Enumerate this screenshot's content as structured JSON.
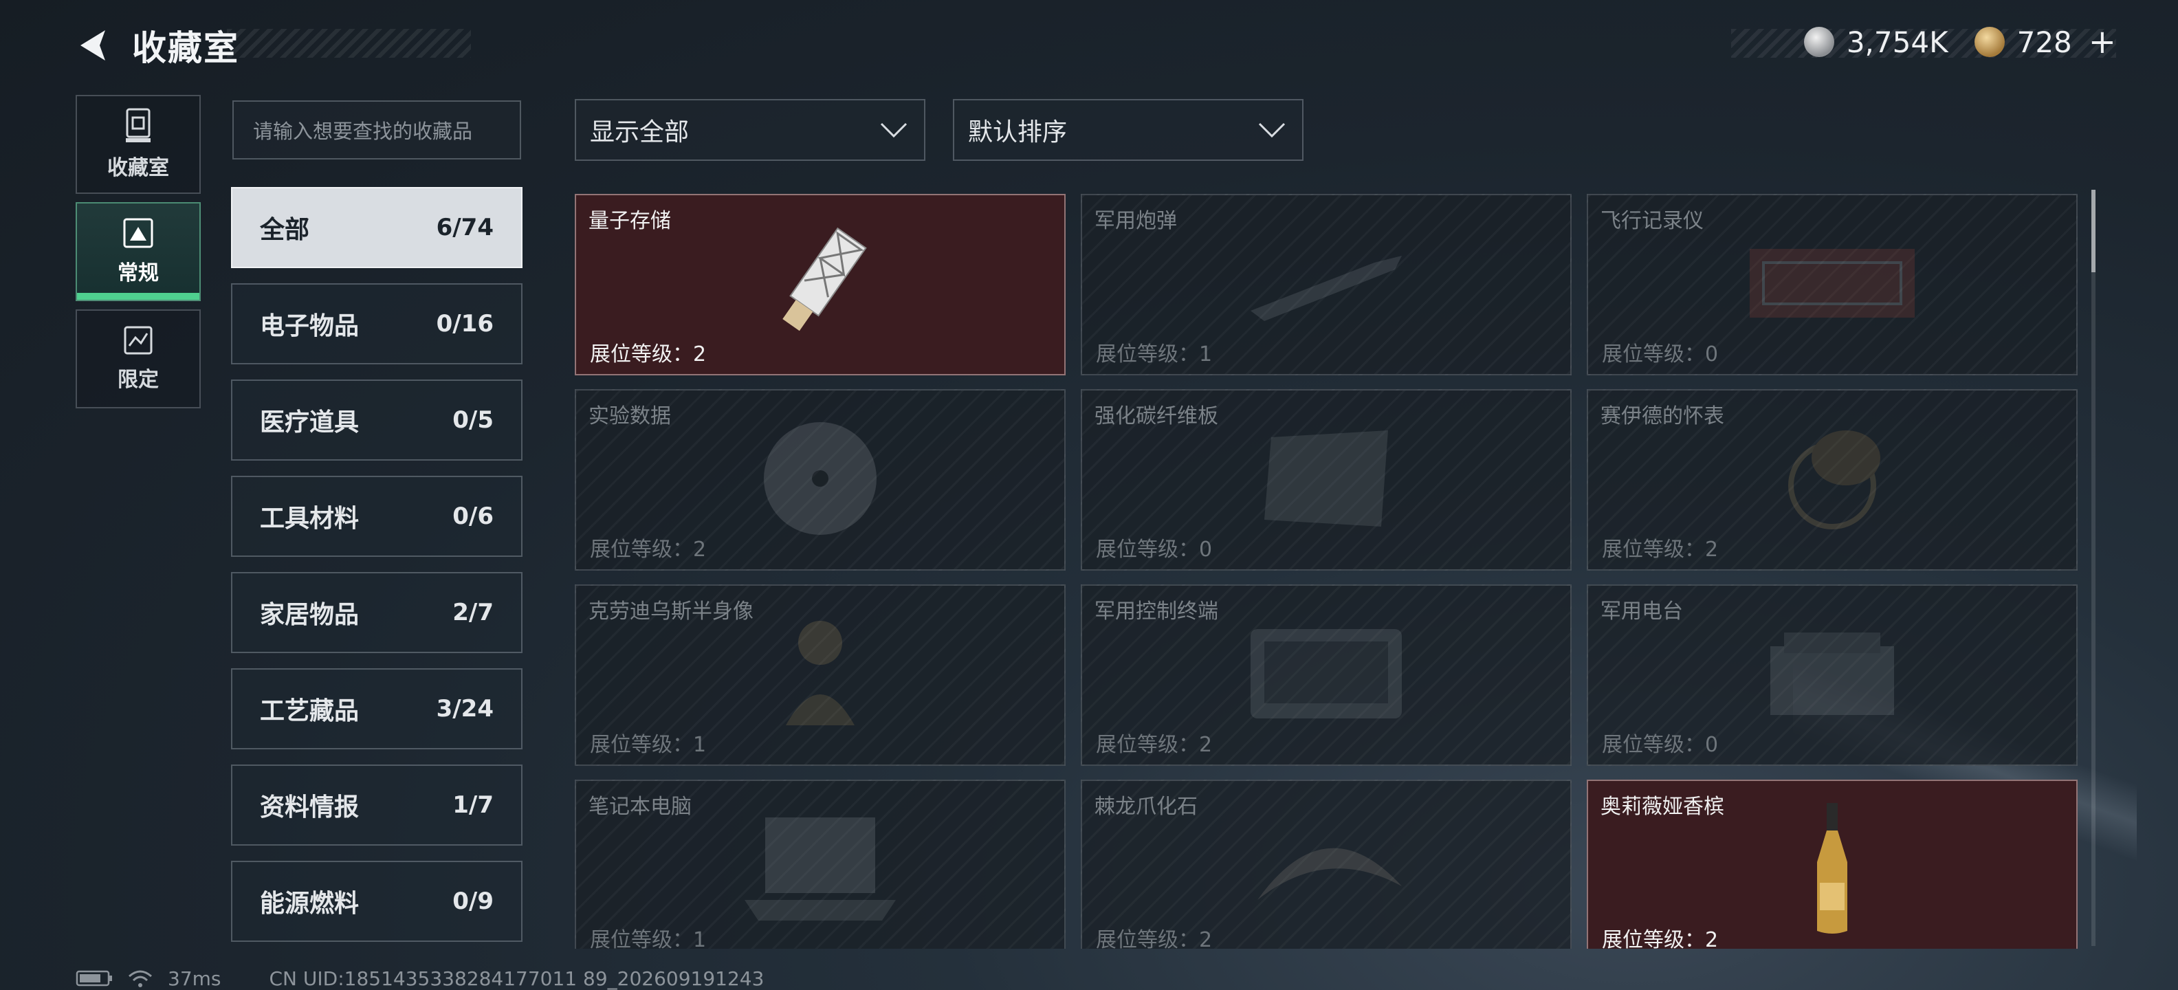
{
  "header": {
    "title": "收藏室"
  },
  "currency": {
    "silver": "3,754K",
    "gold": "728"
  },
  "left_nav": [
    {
      "label": "收藏室",
      "icon": "collection-icon",
      "active": false
    },
    {
      "label": "常规",
      "icon": "regular-icon",
      "active": true
    },
    {
      "label": "限定",
      "icon": "limited-icon",
      "active": false
    }
  ],
  "search": {
    "placeholder": "请输入想要查找的收藏品"
  },
  "categories": [
    {
      "name": "全部",
      "count": "6/74",
      "active": true
    },
    {
      "name": "电子物品",
      "count": "0/16"
    },
    {
      "name": "医疗道具",
      "count": "0/5"
    },
    {
      "name": "工具材料",
      "count": "0/6"
    },
    {
      "name": "家居物品",
      "count": "2/7"
    },
    {
      "name": "工艺藏品",
      "count": "3/24"
    },
    {
      "name": "资料情报",
      "count": "1/7"
    },
    {
      "name": "能源燃料",
      "count": "0/9"
    }
  ],
  "filters": {
    "show": "显示全部",
    "sort": "默认排序"
  },
  "items": [
    {
      "name": "量子存储",
      "level": "展位等级：2",
      "owned": true,
      "icon": "usb-drive-icon"
    },
    {
      "name": "军用炮弹",
      "level": "展位等级：1",
      "owned": false,
      "icon": "artillery-shell-icon"
    },
    {
      "name": "飞行记录仪",
      "level": "展位等级：0",
      "owned": false,
      "icon": "flight-recorder-icon"
    },
    {
      "name": "实验数据",
      "level": "展位等级：2",
      "owned": false,
      "icon": "disc-icon"
    },
    {
      "name": "强化碳纤维板",
      "level": "展位等级：0",
      "owned": false,
      "icon": "carbon-plate-icon"
    },
    {
      "name": "赛伊德的怀表",
      "level": "展位等级：2",
      "owned": false,
      "icon": "pocket-watch-icon"
    },
    {
      "name": "克劳迪乌斯半身像",
      "level": "展位等级：1",
      "owned": false,
      "icon": "bust-icon"
    },
    {
      "name": "军用控制终端",
      "level": "展位等级：2",
      "owned": false,
      "icon": "control-terminal-icon"
    },
    {
      "name": "军用电台",
      "level": "展位等级：0",
      "owned": false,
      "icon": "military-radio-icon"
    },
    {
      "name": "笔记本电脑",
      "level": "展位等级：1",
      "owned": false,
      "icon": "laptop-icon"
    },
    {
      "name": "棘龙爪化石",
      "level": "展位等级：2",
      "owned": false,
      "icon": "claw-fossil-icon"
    },
    {
      "name": "奥莉薇娅香槟",
      "level": "展位等级：2",
      "owned": true,
      "icon": "champagne-bottle-icon"
    }
  ],
  "status_bar": {
    "ping": "37ms",
    "uid": "CN UID:1851435338284177011 89_202609191243"
  }
}
